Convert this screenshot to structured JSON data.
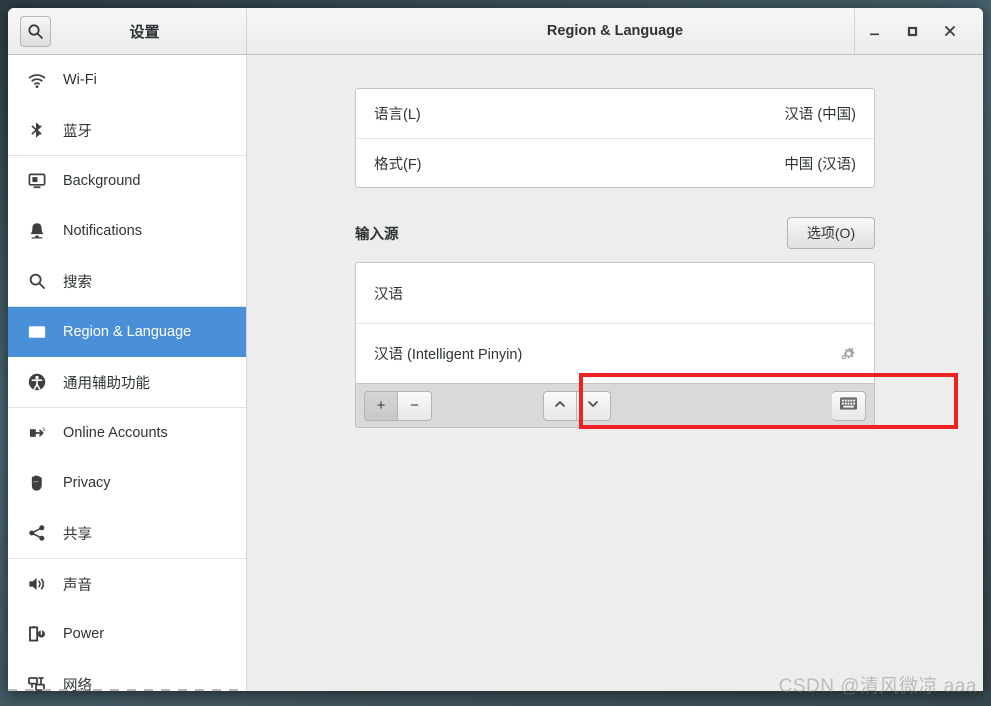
{
  "window": {
    "sidebar_title": "设置",
    "title": "Region & Language",
    "search_icon": "search-icon",
    "controls": {
      "minimize": "−",
      "maximize": "□",
      "close": "×",
      "minimize_name": "minimize-button",
      "maximize_name": "maximize-button",
      "close_name": "close-button"
    }
  },
  "sidebar": {
    "items": [
      {
        "label": "Wi-Fi",
        "icon": "wifi-icon",
        "selected": false
      },
      {
        "label": "蓝牙",
        "icon": "bluetooth-icon",
        "selected": false
      },
      {
        "label": "Background",
        "icon": "monitor-icon",
        "selected": false
      },
      {
        "label": "Notifications",
        "icon": "bell-icon",
        "selected": false
      },
      {
        "label": "搜索",
        "icon": "search-icon",
        "selected": false
      },
      {
        "label": "Region & Language",
        "icon": "region-language-icon",
        "selected": true
      },
      {
        "label": "通用辅助功能",
        "icon": "accessibility-icon",
        "selected": false
      },
      {
        "label": "Online Accounts",
        "icon": "online-accounts-icon",
        "selected": false
      },
      {
        "label": "Privacy",
        "icon": "hand-icon",
        "selected": false
      },
      {
        "label": "共享",
        "icon": "share-icon",
        "selected": false
      },
      {
        "label": "声音",
        "icon": "speaker-icon",
        "selected": false
      },
      {
        "label": "Power",
        "icon": "power-battery-icon",
        "selected": false
      },
      {
        "label": "网络",
        "icon": "network-icon",
        "selected": false
      }
    ],
    "separators_after": [
      1,
      4,
      6,
      9
    ]
  },
  "main": {
    "language_card": [
      {
        "label": "语言(L)",
        "value": "汉语 (中国)"
      },
      {
        "label": "格式(F)",
        "value": "中国 (汉语)"
      }
    ],
    "input_sources": {
      "heading": "输入源",
      "options_button": "选项(O)",
      "rows": [
        {
          "label": "汉语",
          "has_gear": false,
          "highlighted": false
        },
        {
          "label": "汉语 (Intelligent Pinyin)",
          "has_gear": true,
          "highlighted": true
        }
      ],
      "toolbar": {
        "add": "+",
        "remove": "−",
        "move_up": "chevron-up-icon",
        "move_down": "chevron-down-icon",
        "keyboard": "keyboard-icon"
      }
    }
  },
  "annotation": {
    "color": "#ee2222"
  },
  "watermark": {
    "text": "CSDN @清风微凉 aaa"
  },
  "colors": {
    "selection_blue": "#4a90d9",
    "window_bg": "#ededed",
    "sidebar_bg": "#ffffff",
    "annotation_red": "#ee2222"
  }
}
